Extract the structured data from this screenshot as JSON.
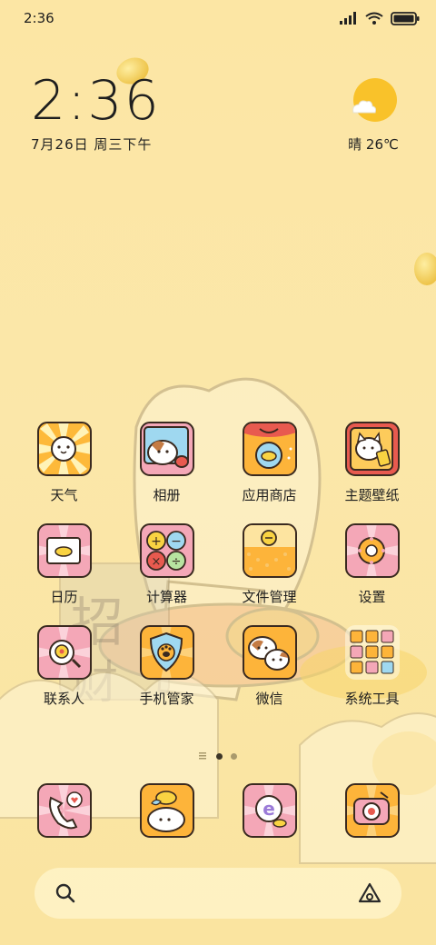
{
  "status_bar": {
    "time": "2:36",
    "icons": [
      "signal-icon",
      "wifi-icon",
      "battery-icon"
    ]
  },
  "clock_widget": {
    "time": "2:36",
    "date": "7月26日 周三下午"
  },
  "weather_widget": {
    "text": "晴 26℃",
    "icon": "sunny-cloud-icon"
  },
  "apps": [
    {
      "name": "weather",
      "label": "天气",
      "icon": "weather-app-icon"
    },
    {
      "name": "gallery",
      "label": "相册",
      "icon": "gallery-app-icon"
    },
    {
      "name": "app-store",
      "label": "应用商店",
      "icon": "app-store-icon"
    },
    {
      "name": "themes",
      "label": "主题壁纸",
      "icon": "themes-app-icon"
    },
    {
      "name": "calendar",
      "label": "日历",
      "icon": "calendar-app-icon"
    },
    {
      "name": "calculator",
      "label": "计算器",
      "icon": "calculator-app-icon"
    },
    {
      "name": "file-manager",
      "label": "文件管理",
      "icon": "file-manager-app-icon"
    },
    {
      "name": "settings",
      "label": "设置",
      "icon": "settings-app-icon"
    },
    {
      "name": "contacts",
      "label": "联系人",
      "icon": "contacts-app-icon"
    },
    {
      "name": "security",
      "label": "手机管家",
      "icon": "security-app-icon"
    },
    {
      "name": "wechat",
      "label": "微信",
      "icon": "wechat-app-icon"
    },
    {
      "name": "system-tools",
      "label": "系统工具",
      "icon": "system-tools-folder-icon"
    }
  ],
  "page_indicator": {
    "pages": 2,
    "current": 1
  },
  "dock": [
    {
      "name": "phone",
      "icon": "phone-app-icon"
    },
    {
      "name": "messages",
      "icon": "messages-app-icon"
    },
    {
      "name": "browser",
      "icon": "browser-app-icon"
    },
    {
      "name": "camera",
      "icon": "camera-app-icon"
    }
  ],
  "search_bar": {
    "left_icon": "search-icon",
    "right_icon": "assistant-icon"
  },
  "colors": {
    "wallpaper": "#FCE8A8",
    "icon_outline": "#3a2a20",
    "orange": "#FDB43A",
    "pink": "#F4A7B7",
    "red": "#E85A4F"
  }
}
